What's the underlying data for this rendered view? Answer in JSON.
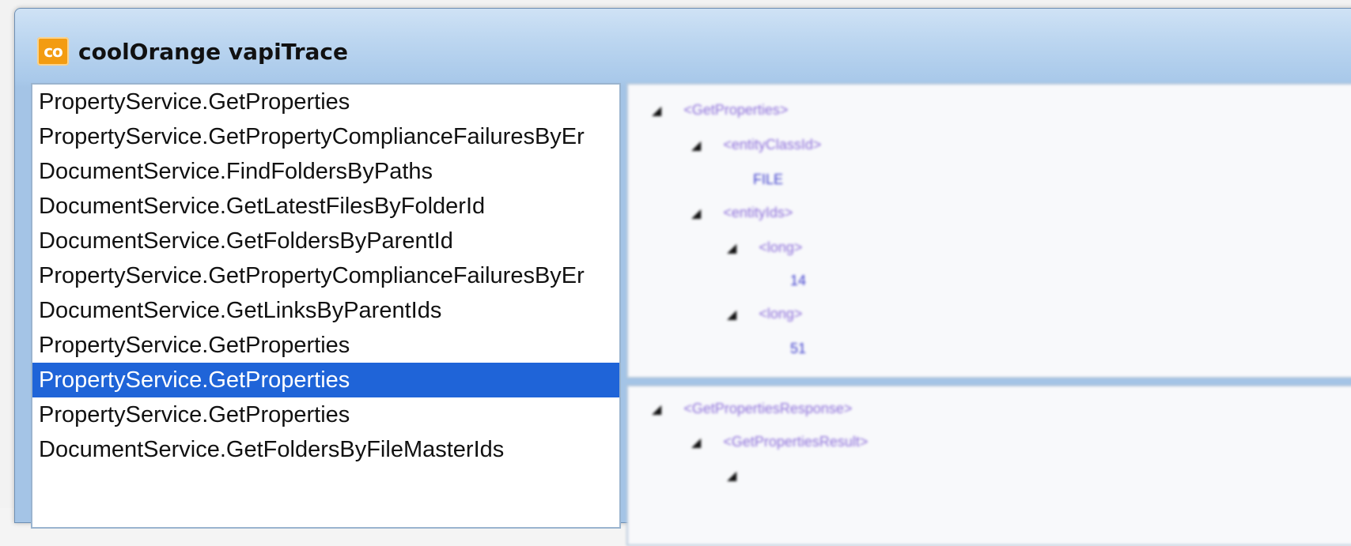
{
  "window": {
    "title": "coolOrange vapiTrace",
    "icon_text": "co",
    "icon": "coolorange-logo-icon",
    "accent_color": "#f39c12"
  },
  "calls": [
    {
      "label": "PropertyService.GetProperties",
      "selected": false
    },
    {
      "label": "PropertyService.GetPropertyComplianceFailuresByEr",
      "selected": false
    },
    {
      "label": "DocumentService.FindFoldersByPaths",
      "selected": false
    },
    {
      "label": "DocumentService.GetLatestFilesByFolderId",
      "selected": false
    },
    {
      "label": "DocumentService.GetFoldersByParentId",
      "selected": false
    },
    {
      "label": "PropertyService.GetPropertyComplianceFailuresByEr",
      "selected": false
    },
    {
      "label": "DocumentService.GetLinksByParentIds",
      "selected": false
    },
    {
      "label": "PropertyService.GetProperties",
      "selected": false
    },
    {
      "label": "PropertyService.GetProperties",
      "selected": true
    },
    {
      "label": "PropertyService.GetProperties",
      "selected": false
    },
    {
      "label": "DocumentService.GetFoldersByFileMasterIds",
      "selected": false
    }
  ],
  "selection_color": "#1f64d8",
  "request_xml": {
    "root": "<GetProperties>",
    "class_tag": "<entityClassId>",
    "class_value": "FILE",
    "ids_tag": "<entityIds>",
    "long_tag_1": "<long>",
    "long_value_1": "14",
    "long_tag_2": "<long>",
    "long_value_2": "51"
  },
  "response_xml": {
    "root": "<GetPropertiesResponse>",
    "result_tag": "<GetPropertiesResult>"
  }
}
